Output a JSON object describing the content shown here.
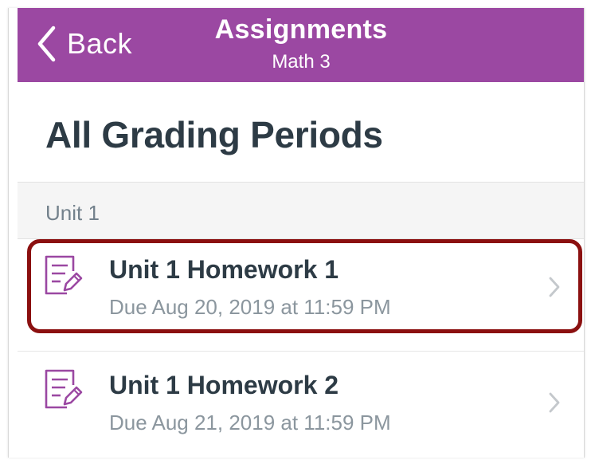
{
  "navbar": {
    "back_label": "Back",
    "title": "Assignments",
    "subtitle": "Math 3",
    "color": "#9b48a2"
  },
  "page_title": "All Grading Periods",
  "section": {
    "label": "Unit 1"
  },
  "assignments": [
    {
      "title": "Unit 1 Homework 1",
      "due": "Due Aug 20, 2019 at 11:59 PM",
      "icon": "assignment-icon",
      "highlighted": true
    },
    {
      "title": "Unit 1 Homework 2",
      "due": "Due Aug 21, 2019 at 11:59 PM",
      "icon": "assignment-icon",
      "highlighted": false
    }
  ],
  "colors": {
    "accent": "#9b48a2",
    "highlight_border": "#8b1010",
    "title_text": "#2d3b45",
    "secondary_text": "#8b969e"
  }
}
